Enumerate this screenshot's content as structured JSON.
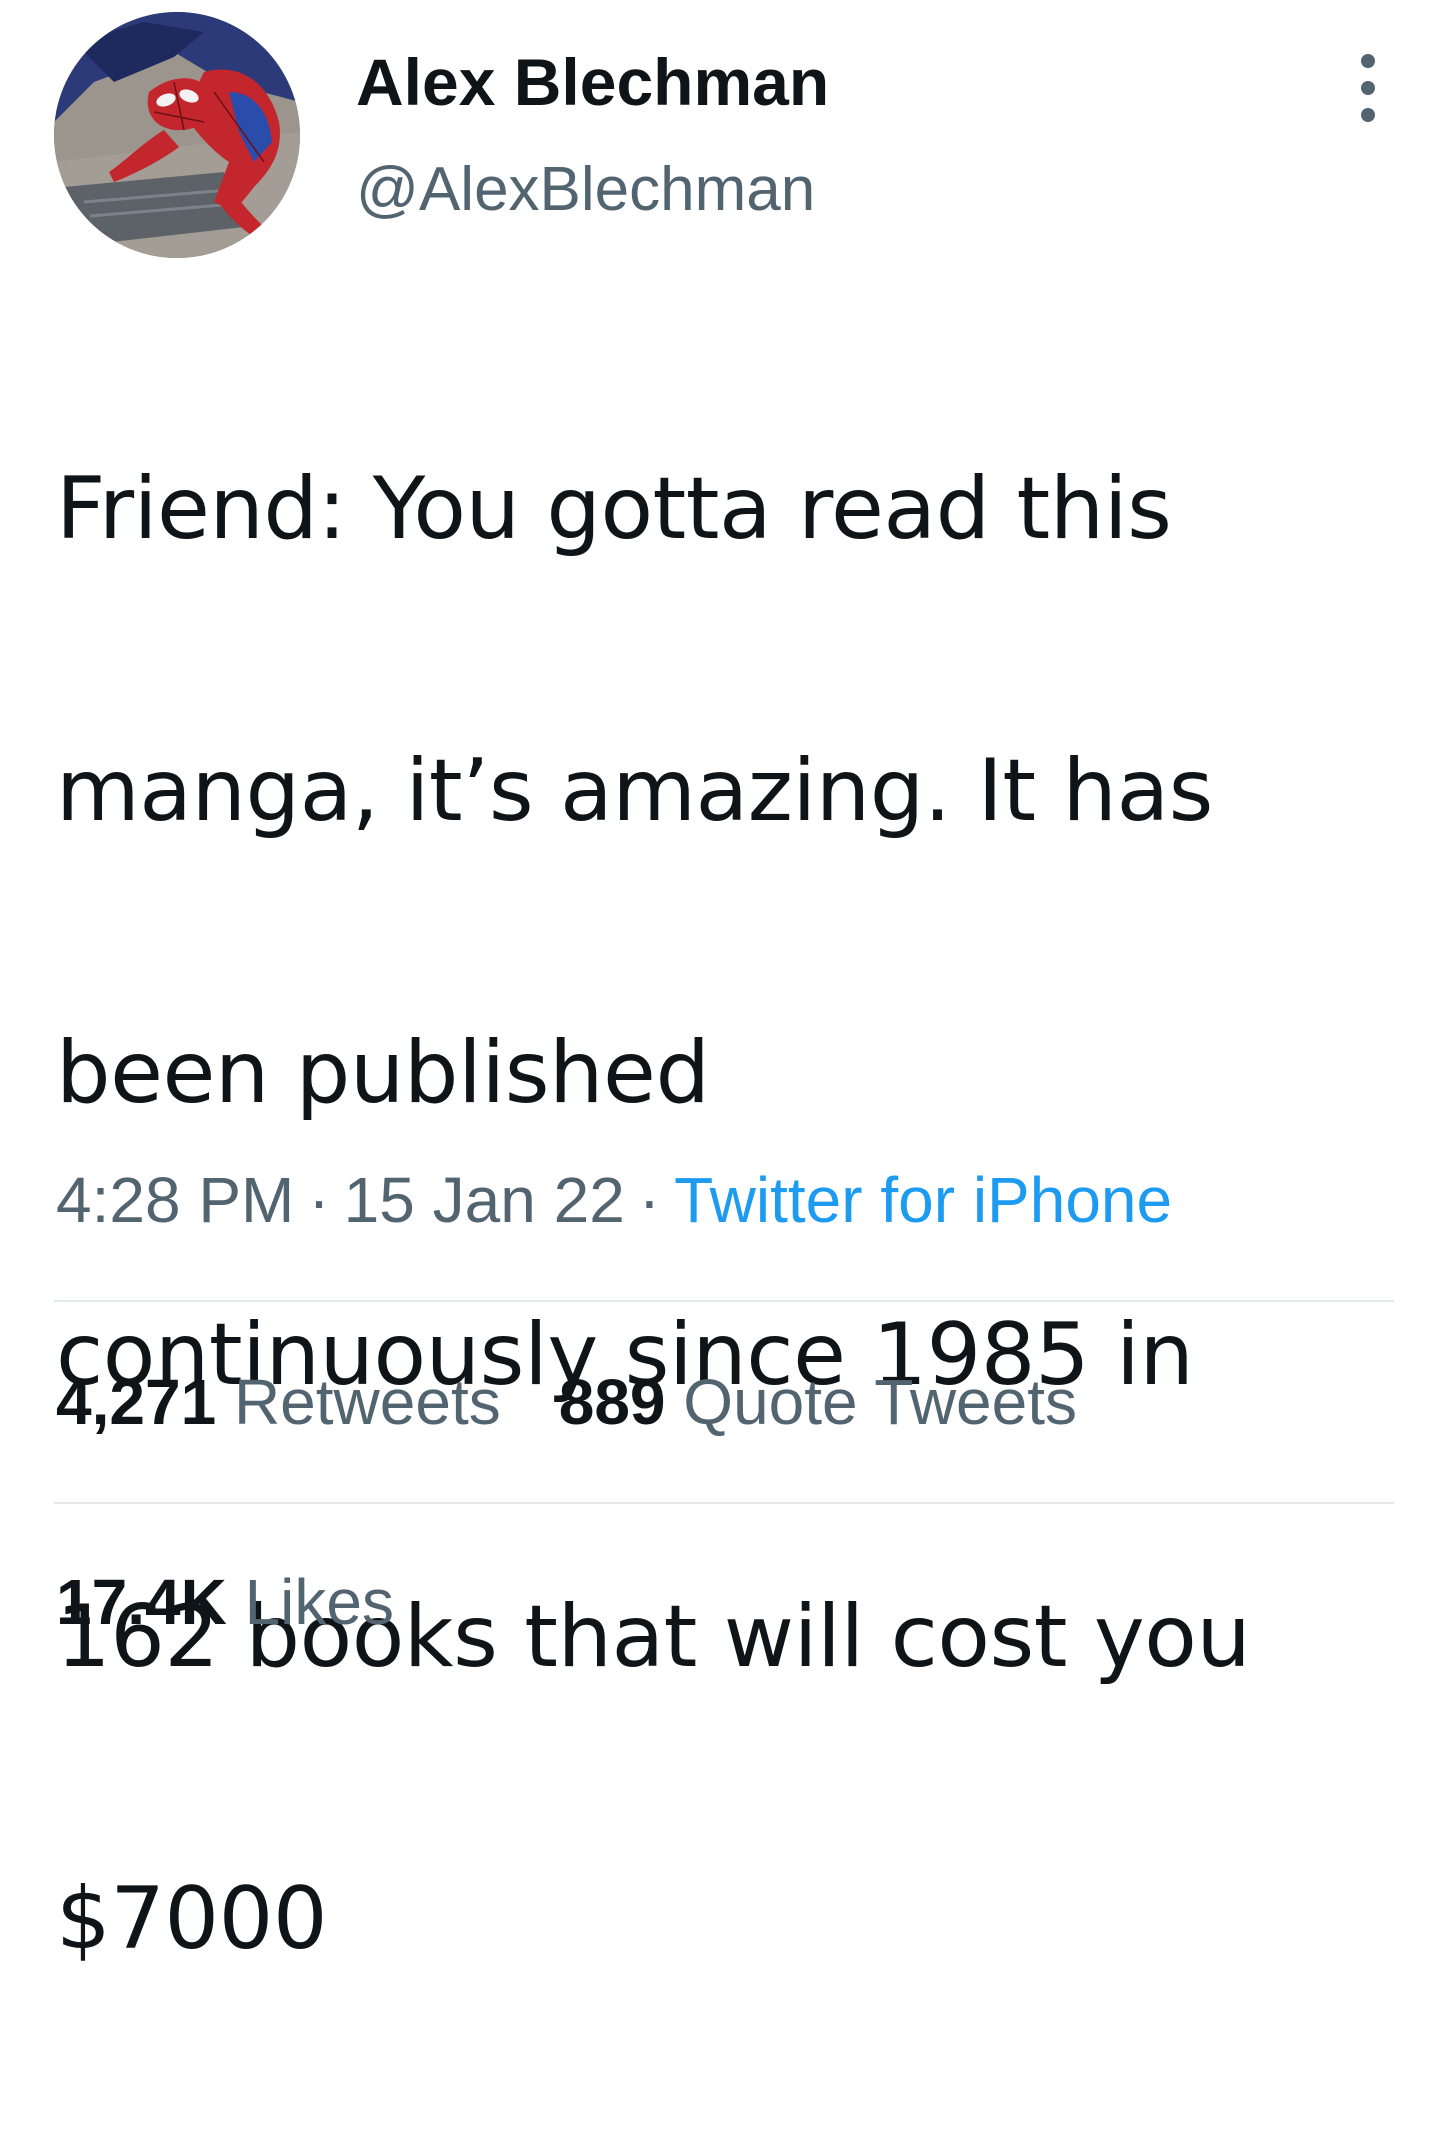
{
  "author": {
    "display_name": "Alex Blechman",
    "handle": "@AlexBlechman",
    "avatar_icon": "spiderman-avatar"
  },
  "more_icon": "more-options-icon",
  "tweet": {
    "text": "Friend: You gotta read this manga, it’s amazing. It has been published continuously since 1985 in 162 books that will cost you $7000",
    "lines": [
      "Friend: You gotta read this",
      "manga, it’s amazing. It has",
      "been published",
      "continuously since 1985 in",
      "162 books that will cost you",
      "$7000"
    ]
  },
  "meta": {
    "time": "4:28 PM",
    "separator": "·",
    "date": "15 Jan 22",
    "source": "Twitter for iPhone",
    "source_color": "#1d9bf0"
  },
  "stats": {
    "retweets": {
      "count": "4,271",
      "label": "Retweets"
    },
    "quotes": {
      "count": "889",
      "label": "Quote Tweets"
    },
    "likes": {
      "count": "17.4K",
      "label": "Likes"
    }
  },
  "colors": {
    "text_primary": "#0f1419",
    "text_secondary": "#536471",
    "divider": "#e4e9ec"
  }
}
